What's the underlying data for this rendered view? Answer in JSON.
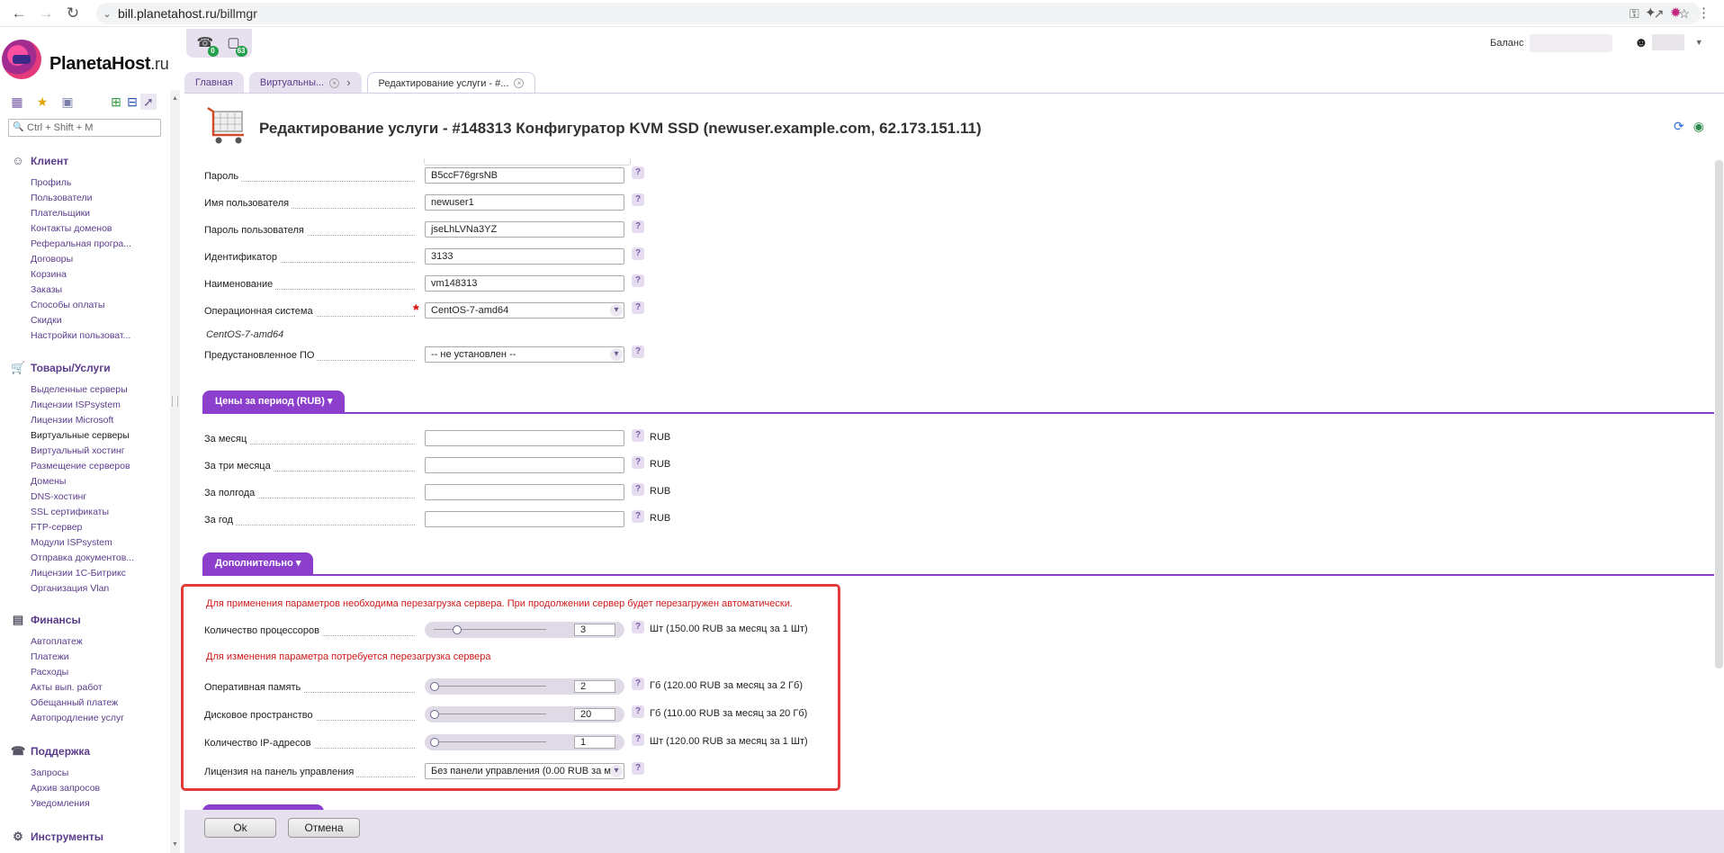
{
  "browser": {
    "url_host": "bill.planetahost.ru",
    "url_path": "/billmgr"
  },
  "brand": {
    "name": "PlanetaHost",
    "tld": ".ru"
  },
  "notifications": [
    {
      "icon": "support-headset-icon",
      "count": "0"
    },
    {
      "icon": "monitor-icon",
      "count": "63"
    }
  ],
  "header": {
    "balance_label": "Баланс"
  },
  "tabs": [
    {
      "label": "Главная",
      "active": false
    },
    {
      "label": "Виртуальны...",
      "active": false
    },
    {
      "label": "Редактирование услуги - #...",
      "active": true
    }
  ],
  "sidebar": {
    "search_placeholder": "Ctrl + Shift + M",
    "groups": [
      {
        "title": "Клиент",
        "icon": "person-icon",
        "items": [
          "Профиль",
          "Пользователи",
          "Плательщики",
          "Контакты доменов",
          "Реферальная програ...",
          "Договоры",
          "Корзина",
          "Заказы",
          "Способы оплаты",
          "Скидки",
          "Настройки пользоват..."
        ]
      },
      {
        "title": "Товары/Услуги",
        "icon": "cart-icon",
        "items": [
          "Выделенные серверы",
          "Лицензии ISPsystem",
          "Лицензии Microsoft",
          "Виртуальные серверы",
          "Виртуальный хостинг",
          "Размещение серверов",
          "Домены",
          "DNS-хостинг",
          "SSL сертификаты",
          "FTP-сервер",
          "Модули ISPsystem",
          "Отправка документов...",
          "Лицензии 1С-Битрикс",
          "Организация Vlan"
        ]
      },
      {
        "title": "Финансы",
        "icon": "finance-icon",
        "items": [
          "Автоплатеж",
          "Платежи",
          "Расходы",
          "Акты вып. работ",
          "Обещанный платеж",
          "Автопродление услуг"
        ]
      },
      {
        "title": "Поддержка",
        "icon": "headset-icon",
        "items": [
          "Запросы",
          "Архив запросов",
          "Уведомления"
        ]
      },
      {
        "title": "Инструменты",
        "icon": "tools-icon",
        "items": []
      }
    ]
  },
  "page": {
    "title": "Редактирование услуги - #148313 Конфигуратор KVM SSD (newuser.example.com, 62.173.151.11)"
  },
  "fields": [
    {
      "label": "Пароль",
      "value": "B5ccF76grsNB"
    },
    {
      "label": "Имя пользователя",
      "value": "newuser1"
    },
    {
      "label": "Пароль пользователя",
      "value": "jseLhLVNa3YZ"
    },
    {
      "label": "Идентификатор",
      "value": "3133"
    },
    {
      "label": "Наименование",
      "value": "vm148313"
    },
    {
      "label": "Операционная система",
      "value": "CentOS-7-amd64",
      "required": true,
      "note": "CentOS-7-amd64"
    },
    {
      "label": "Предустановленное ПО",
      "value": "-- не установлен --"
    }
  ],
  "prices_section": {
    "title": "Цены за период (RUB)",
    "rows": [
      {
        "label": "За месяц",
        "value": "",
        "unit": "RUB"
      },
      {
        "label": "За три месяца",
        "value": "",
        "unit": "RUB"
      },
      {
        "label": "За полгода",
        "value": "",
        "unit": "RUB"
      },
      {
        "label": "За год",
        "value": "",
        "unit": "RUB"
      }
    ]
  },
  "extra_section": {
    "title": "Дополнительно",
    "warning_reboot": "Для применения параметров необходима перезагрузка сервера. При продолжении сервер будет перезагружен автоматически.",
    "warning_param": "Для изменения параметра потребуется перезагрузка сервера",
    "cpu": {
      "label": "Количество процессоров",
      "value": "3",
      "level": 0.2,
      "unit": "Шт (150.00 RUB за месяц за 1 Шт)"
    },
    "ram": {
      "label": "Оперативная память",
      "value": "2",
      "level": 0.0,
      "unit": "Гб (120.00 RUB за месяц за 2 Гб)"
    },
    "disk": {
      "label": "Дисковое пространство",
      "value": "20",
      "level": 0.0,
      "unit": "Гб (110.00 RUB за месяц за 20 Гб)"
    },
    "ip": {
      "label": "Количество IP-адресов",
      "value": "1",
      "level": 0.0,
      "unit": "Шт (120.00 RUB за месяц за 1 Шт)"
    },
    "license": {
      "label": "Лицензия на панель управления",
      "value": "Без панели управления (0.00 RUB за м"
    }
  },
  "footer": {
    "ok_label": "Ok",
    "cancel_label": "Отмена"
  },
  "colors": {
    "accent": "#8b3fcc",
    "link": "#5a3c8c",
    "warning": "#d11a1a",
    "highlight_box": "#e23b3b"
  }
}
